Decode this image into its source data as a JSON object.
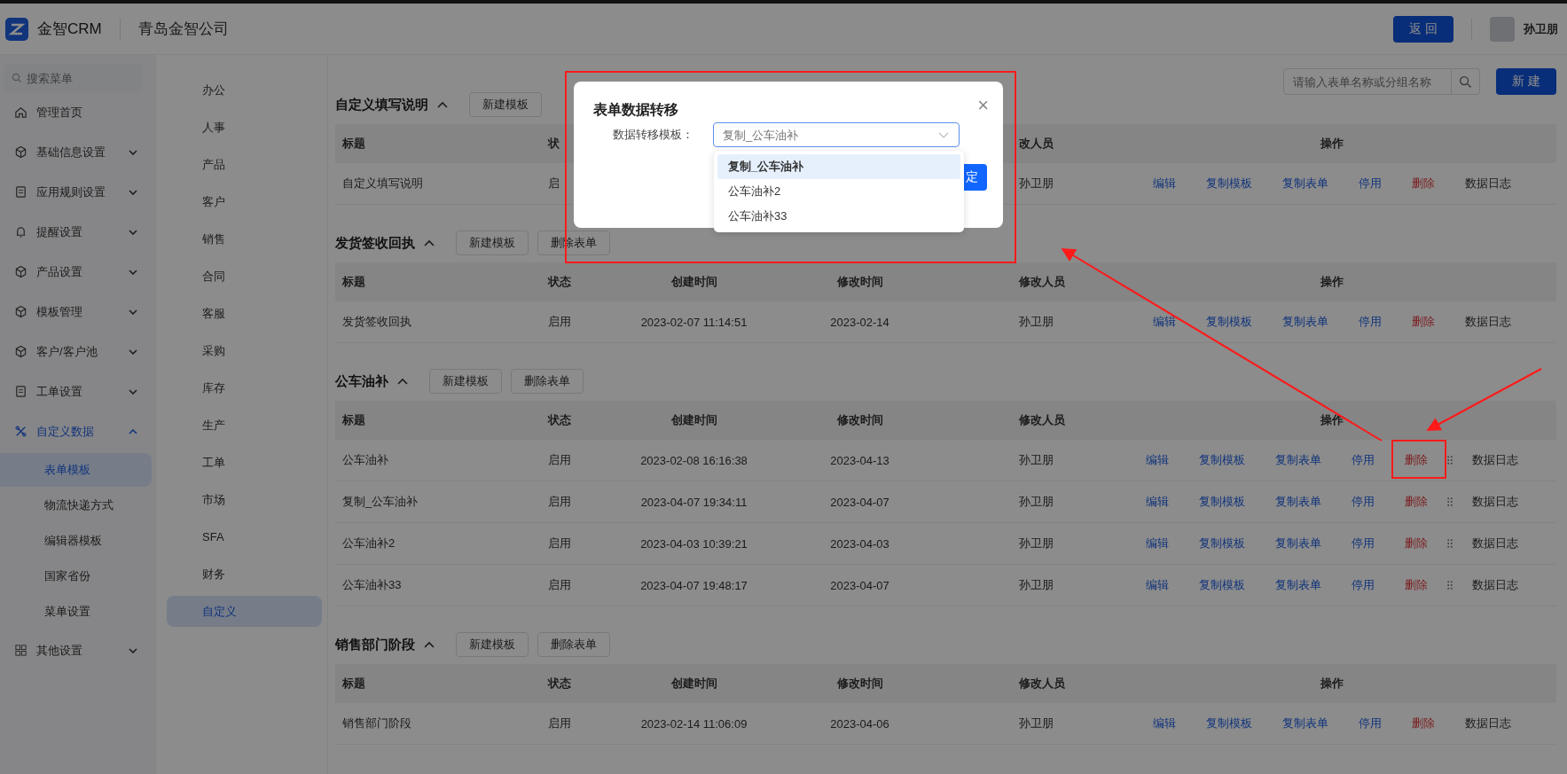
{
  "header": {
    "brand": "金智CRM",
    "company": "青岛金智公司",
    "back_button": "返 回",
    "user": "孙卫朋"
  },
  "sidebar": {
    "search_placeholder": "搜索菜单",
    "items": [
      {
        "label": "管理首页",
        "kind": "link"
      },
      {
        "label": "基础信息设置",
        "kind": "group",
        "expanded": false
      },
      {
        "label": "应用规则设置",
        "kind": "group",
        "expanded": false
      },
      {
        "label": "提醒设置",
        "kind": "group",
        "expanded": false
      },
      {
        "label": "产品设置",
        "kind": "group",
        "expanded": false
      },
      {
        "label": "模板管理",
        "kind": "group",
        "expanded": false
      },
      {
        "label": "客户/客户池",
        "kind": "group",
        "expanded": false
      },
      {
        "label": "工单设置",
        "kind": "group",
        "expanded": false
      },
      {
        "label": "自定义数据",
        "kind": "group",
        "expanded": true,
        "children": [
          {
            "label": "表单模板",
            "selected": true
          },
          {
            "label": "物流快递方式",
            "selected": false
          },
          {
            "label": "编辑器模板",
            "selected": false
          },
          {
            "label": "国家省份",
            "selected": false
          },
          {
            "label": "菜单设置",
            "selected": false
          }
        ]
      },
      {
        "label": "其他设置",
        "kind": "group",
        "expanded": false
      }
    ]
  },
  "categories": [
    {
      "label": "办公",
      "selected": false
    },
    {
      "label": "人事",
      "selected": false
    },
    {
      "label": "产品",
      "selected": false
    },
    {
      "label": "客户",
      "selected": false
    },
    {
      "label": "销售",
      "selected": false
    },
    {
      "label": "合同",
      "selected": false
    },
    {
      "label": "客服",
      "selected": false
    },
    {
      "label": "采购",
      "selected": false
    },
    {
      "label": "库存",
      "selected": false
    },
    {
      "label": "生产",
      "selected": false
    },
    {
      "label": "工单",
      "selected": false
    },
    {
      "label": "市场",
      "selected": false
    },
    {
      "label": "SFA",
      "selected": false
    },
    {
      "label": "财务",
      "selected": false
    },
    {
      "label": "自定义",
      "selected": true
    }
  ],
  "toolbar": {
    "search_placeholder": "请输入表单名称或分组名称",
    "new_button": "新 建"
  },
  "sections": [
    {
      "title": "自定义填写说明",
      "expanded": true,
      "buttons": [
        "新建模板"
      ],
      "columns": {
        "title": "标题",
        "status": "状",
        "modifier": "改人员",
        "actions": "操作"
      },
      "rows": [
        {
          "title": "自定义填写说明",
          "status": "启",
          "modifier": "孙卫朋",
          "draggable": false,
          "actions": [
            {
              "label": "编辑",
              "kind": "link"
            },
            {
              "label": "复制模板",
              "kind": "link"
            },
            {
              "label": "复制表单",
              "kind": "link"
            },
            {
              "label": "停用",
              "kind": "link"
            },
            {
              "label": "删除",
              "kind": "danger"
            },
            {
              "label": "数据日志",
              "kind": "plain"
            }
          ]
        }
      ]
    },
    {
      "title": "发货签收回执",
      "expanded": true,
      "buttons": [
        "新建模板",
        "删除表单"
      ],
      "columns": {
        "title": "标题",
        "status": "状态",
        "created": "创建时间",
        "modified": "修改时间",
        "modifier": "修改人员",
        "actions": "操作"
      },
      "rows": [
        {
          "title": "发货签收回执",
          "status": "启用",
          "created": "2023-02-07 11:14:51",
          "modified": "2023-02-14",
          "modifier": "孙卫朋",
          "draggable": false,
          "actions": [
            {
              "label": "编辑",
              "kind": "link"
            },
            {
              "label": "复制模板",
              "kind": "link"
            },
            {
              "label": "复制表单",
              "kind": "link"
            },
            {
              "label": "停用",
              "kind": "link"
            },
            {
              "label": "删除",
              "kind": "danger"
            },
            {
              "label": "数据日志",
              "kind": "plain"
            }
          ]
        }
      ]
    },
    {
      "title": "公车油补",
      "expanded": true,
      "buttons": [
        "新建模板",
        "删除表单"
      ],
      "columns": {
        "title": "标题",
        "status": "状态",
        "created": "创建时间",
        "modified": "修改时间",
        "modifier": "修改人员",
        "actions": "操作"
      },
      "rows": [
        {
          "title": "公车油补",
          "status": "启用",
          "created": "2023-02-08 16:16:38",
          "modified": "2023-04-13",
          "modifier": "孙卫朋",
          "draggable": true,
          "actions": [
            {
              "label": "编辑",
              "kind": "link"
            },
            {
              "label": "复制模板",
              "kind": "link"
            },
            {
              "label": "复制表单",
              "kind": "link"
            },
            {
              "label": "停用",
              "kind": "link"
            },
            {
              "label": "删除",
              "kind": "danger"
            },
            {
              "label": "数据日志",
              "kind": "plain"
            }
          ]
        },
        {
          "title": "复制_公车油补",
          "status": "启用",
          "created": "2023-04-07 19:34:11",
          "modified": "2023-04-07",
          "modifier": "孙卫朋",
          "draggable": true,
          "actions": [
            {
              "label": "编辑",
              "kind": "link"
            },
            {
              "label": "复制模板",
              "kind": "link"
            },
            {
              "label": "复制表单",
              "kind": "link"
            },
            {
              "label": "停用",
              "kind": "link"
            },
            {
              "label": "删除",
              "kind": "danger"
            },
            {
              "label": "数据日志",
              "kind": "plain"
            }
          ]
        },
        {
          "title": "公车油补2",
          "status": "启用",
          "created": "2023-04-03 10:39:21",
          "modified": "2023-04-03",
          "modifier": "孙卫朋",
          "draggable": true,
          "actions": [
            {
              "label": "编辑",
              "kind": "link"
            },
            {
              "label": "复制模板",
              "kind": "link"
            },
            {
              "label": "复制表单",
              "kind": "link"
            },
            {
              "label": "停用",
              "kind": "link"
            },
            {
              "label": "删除",
              "kind": "danger"
            },
            {
              "label": "数据日志",
              "kind": "plain"
            }
          ]
        },
        {
          "title": "公车油补33",
          "status": "启用",
          "created": "2023-04-07 19:48:17",
          "modified": "2023-04-07",
          "modifier": "孙卫朋",
          "draggable": true,
          "actions": [
            {
              "label": "编辑",
              "kind": "link"
            },
            {
              "label": "复制模板",
              "kind": "link"
            },
            {
              "label": "复制表单",
              "kind": "link"
            },
            {
              "label": "停用",
              "kind": "link"
            },
            {
              "label": "删除",
              "kind": "danger"
            },
            {
              "label": "数据日志",
              "kind": "plain"
            }
          ]
        }
      ]
    },
    {
      "title": "销售部门阶段",
      "expanded": true,
      "buttons": [
        "新建模板",
        "删除表单"
      ],
      "columns": {
        "title": "标题",
        "status": "状态",
        "created": "创建时间",
        "modified": "修改时间",
        "modifier": "修改人员",
        "actions": "操作"
      },
      "rows": [
        {
          "title": "销售部门阶段",
          "status": "启用",
          "created": "2023-02-14 11:06:09",
          "modified": "2023-04-06",
          "modifier": "孙卫朋",
          "draggable": false,
          "actions": [
            {
              "label": "编辑",
              "kind": "link"
            },
            {
              "label": "复制模板",
              "kind": "link"
            },
            {
              "label": "复制表单",
              "kind": "link"
            },
            {
              "label": "停用",
              "kind": "link"
            },
            {
              "label": "删除",
              "kind": "danger"
            },
            {
              "label": "数据日志",
              "kind": "plain"
            }
          ]
        }
      ]
    }
  ],
  "dialog": {
    "title": "表单数据转移",
    "close": "×",
    "field_label": "数据转移模板：",
    "placeholder": "复制_公车油补",
    "confirm_visible_text": "定",
    "options": [
      {
        "label": "复制_公车油补",
        "selected": true
      },
      {
        "label": "公车油补2",
        "selected": false
      },
      {
        "label": "公车油补33",
        "selected": false
      }
    ]
  }
}
